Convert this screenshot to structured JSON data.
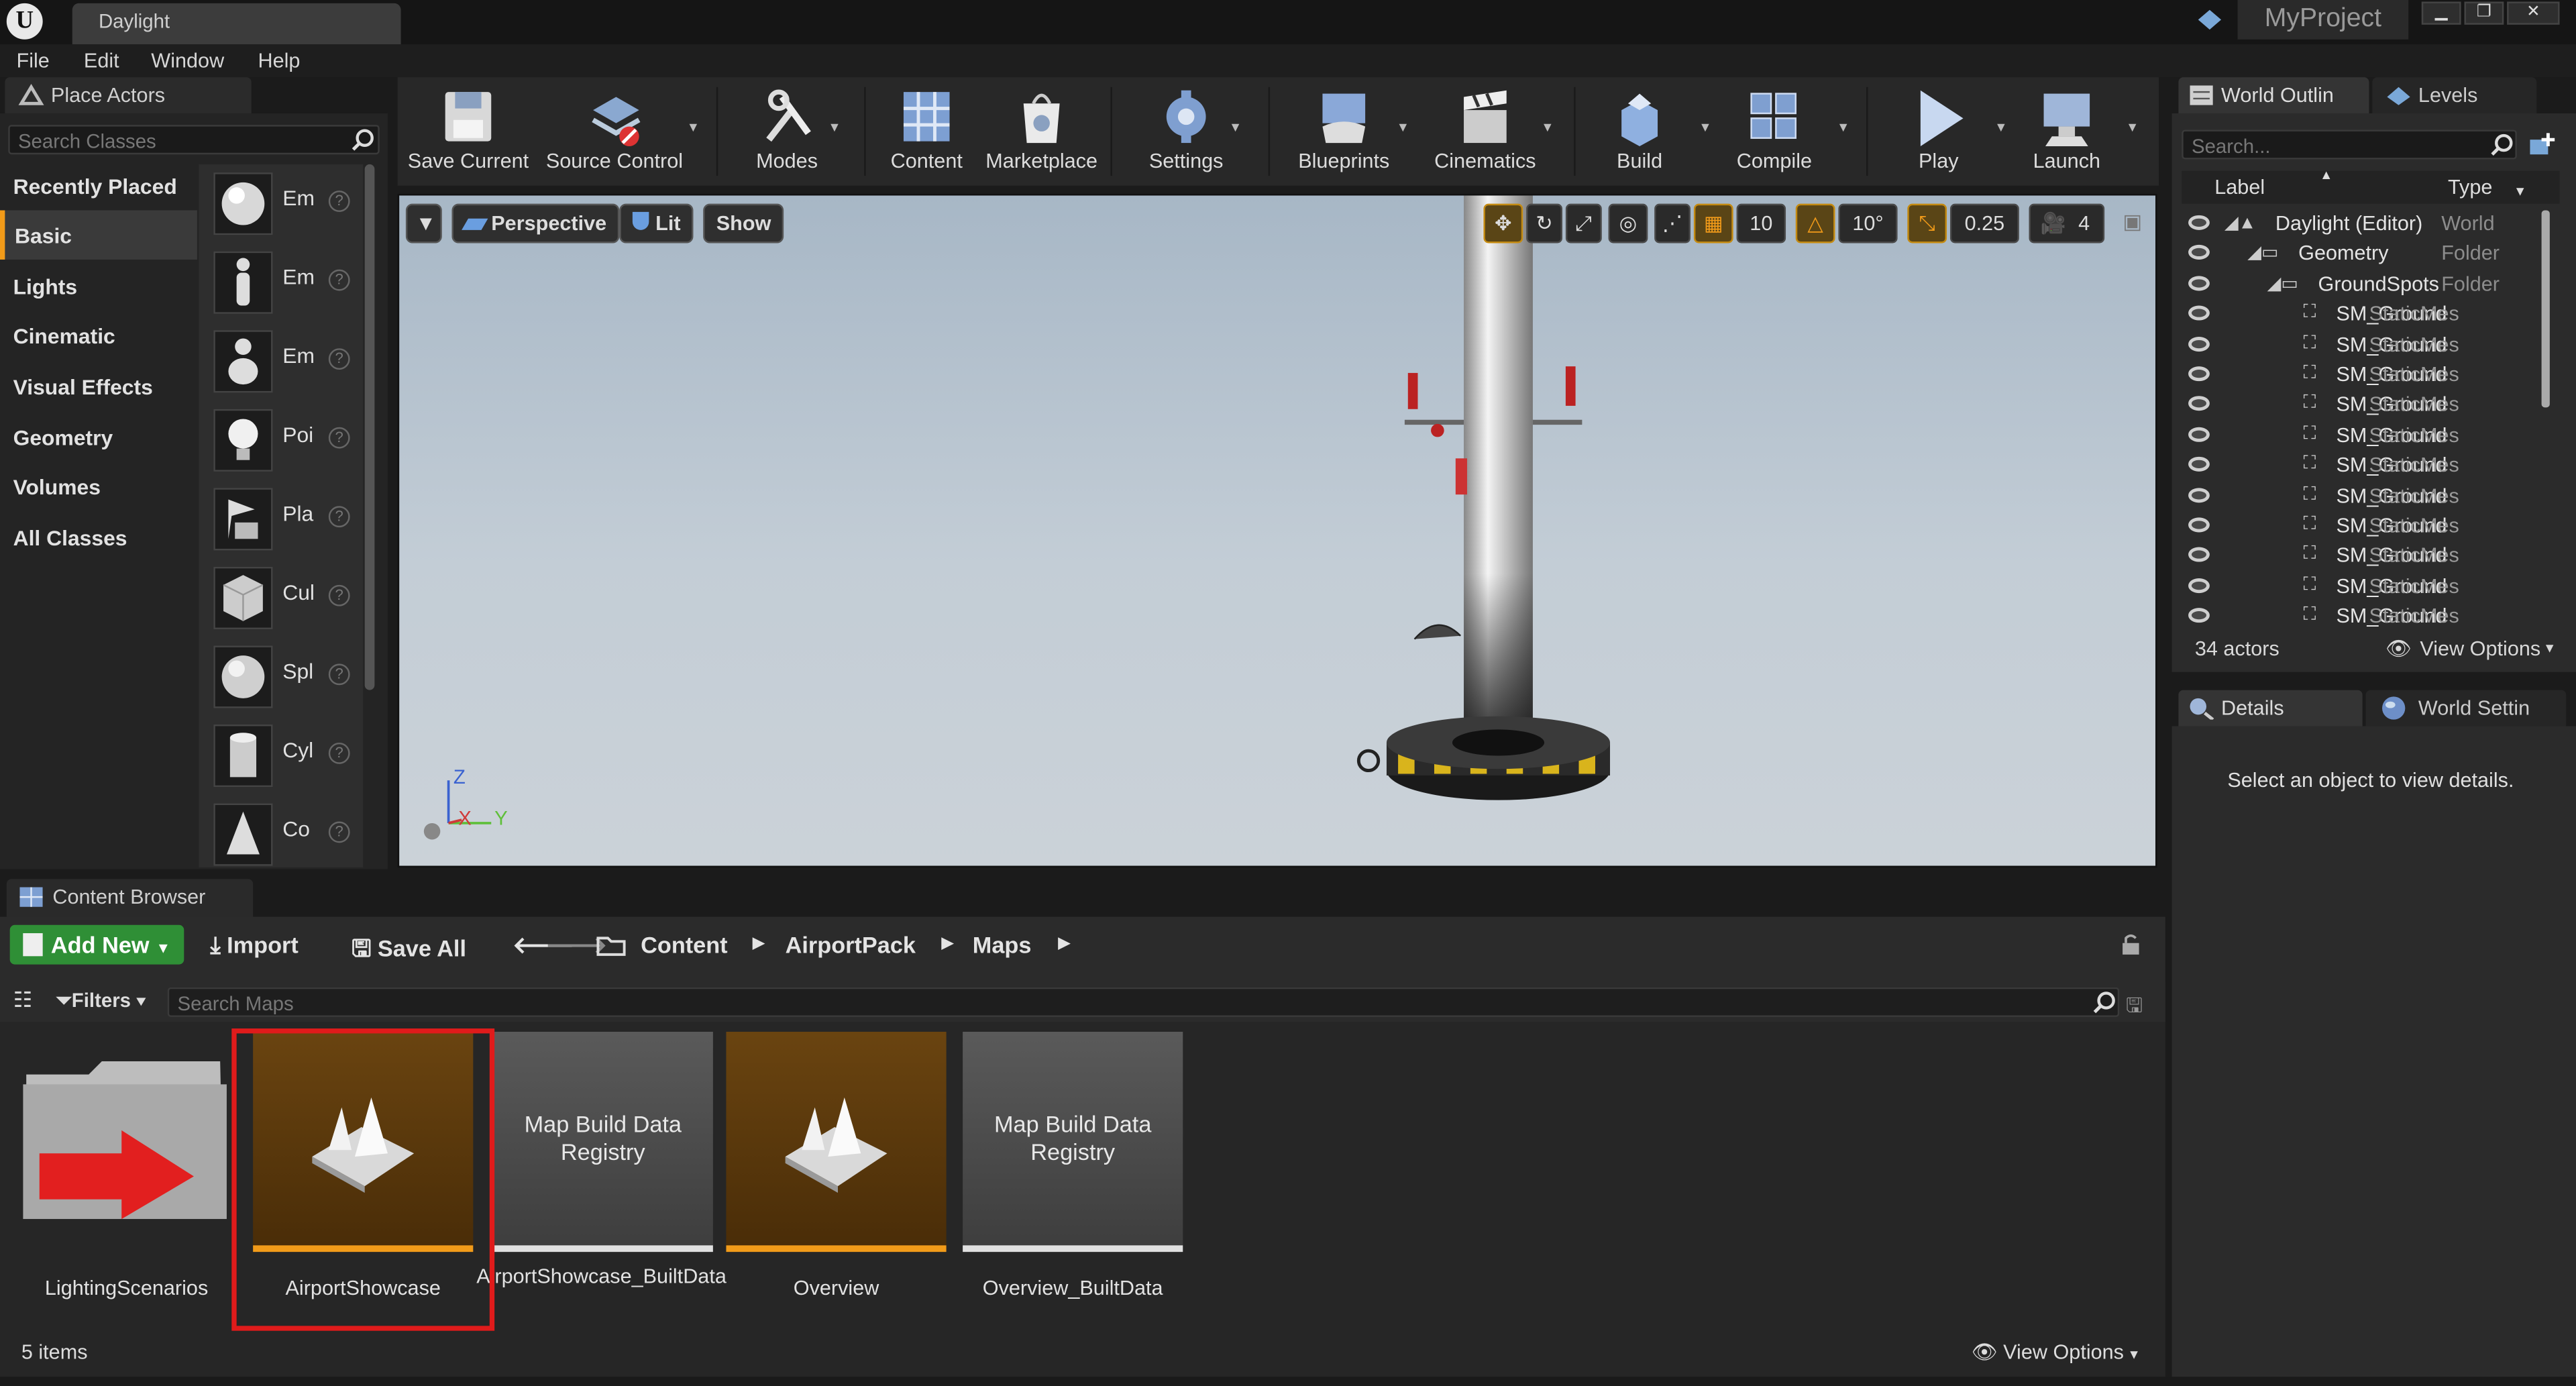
{
  "window": {
    "tab_title": "Daylight",
    "project_name": "MyProject",
    "menu": [
      "File",
      "Edit",
      "Window",
      "Help"
    ]
  },
  "place_actors": {
    "tab_label": "Place Actors",
    "search_placeholder": "Search Classes",
    "categories": [
      "Recently Placed",
      "Basic",
      "Lights",
      "Cinematic",
      "Visual Effects",
      "Geometry",
      "Volumes",
      "All Classes"
    ],
    "selected_category": "Basic",
    "items": [
      "Em",
      "Em",
      "Em",
      "Poi",
      "Pla",
      "Cul",
      "Spl",
      "Cyl",
      "Co"
    ]
  },
  "toolbar": {
    "buttons": [
      "Save Current",
      "Source Control",
      "Modes",
      "Content",
      "Marketplace",
      "Settings",
      "Blueprints",
      "Cinematics",
      "Build",
      "Compile",
      "Play",
      "Launch"
    ]
  },
  "viewport": {
    "perspective_label": "Perspective",
    "lit_label": "Lit",
    "show_label": "Show",
    "grid_snap": "10",
    "rotation_snap": "10°",
    "scale_snap": "0.25",
    "camera_speed": "4",
    "axis_labels": {
      "z": "Z",
      "x": "X",
      "y": "Y"
    }
  },
  "world_outliner": {
    "tab_label": "World Outlin",
    "levels_tab_label": "Levels",
    "search_placeholder": "Search...",
    "col_label": "Label",
    "col_type": "Type",
    "rows": [
      {
        "label": "Daylight (Editor)",
        "type": "World"
      },
      {
        "label": "Geometry",
        "type": "Folder"
      },
      {
        "label": "GroundSpots",
        "type": "Folder"
      },
      {
        "label": "SM_Ground",
        "type": "StaticMes"
      },
      {
        "label": "SM_Ground",
        "type": "StaticMes"
      },
      {
        "label": "SM_Ground",
        "type": "StaticMes"
      },
      {
        "label": "SM_Ground",
        "type": "StaticMes"
      },
      {
        "label": "SM_Ground",
        "type": "StaticMes"
      },
      {
        "label": "SM_Ground",
        "type": "StaticMes"
      },
      {
        "label": "SM_Ground",
        "type": "StaticMes"
      },
      {
        "label": "SM_Ground",
        "type": "StaticMes"
      },
      {
        "label": "SM_Ground",
        "type": "StaticMes"
      },
      {
        "label": "SM_Ground",
        "type": "StaticMes"
      },
      {
        "label": "SM_Ground",
        "type": "StaticMes"
      }
    ],
    "actor_count": "34 actors",
    "view_options": "View Options"
  },
  "details": {
    "tab_label": "Details",
    "world_settings_tab_label": "World Settin",
    "empty_message": "Select an object to view details."
  },
  "content_browser": {
    "tab_label": "Content Browser",
    "add_new": "Add New",
    "import": "Import",
    "save_all": "Save All",
    "breadcrumb": [
      "Content",
      "AirportPack",
      "Maps"
    ],
    "filters_label": "Filters",
    "search_placeholder": "Search Maps",
    "assets": [
      {
        "name": "LightingScenarios",
        "kind": "folder"
      },
      {
        "name": "AirportShowcase",
        "kind": "map",
        "selected": true
      },
      {
        "name": "AirportShowcase_BuiltData",
        "kind": "registry",
        "thumb_text": "Map Build Data Registry"
      },
      {
        "name": "Overview",
        "kind": "map"
      },
      {
        "name": "Overview_BuiltData",
        "kind": "registry",
        "thumb_text": "Map Build Data Registry"
      }
    ],
    "item_count": "5 items",
    "view_options": "View Options"
  },
  "colors": {
    "accent_orange": "#f29b19",
    "add_new_green": "#2f8f36",
    "highlight_red": "#e01b1b"
  }
}
